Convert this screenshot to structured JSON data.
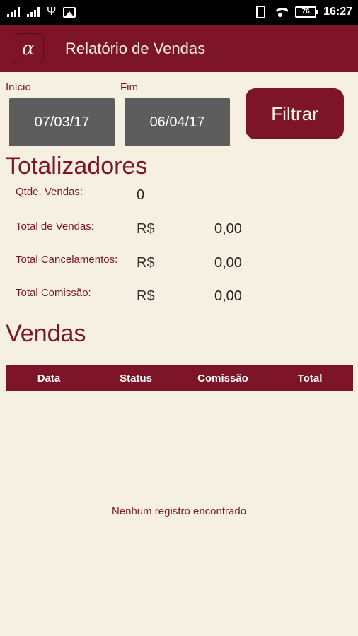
{
  "status_bar": {
    "signal1": "4G",
    "signal2": "4G",
    "battery": "76",
    "time": "16:27"
  },
  "app_bar": {
    "logo_glyph": "α",
    "title": "Relatório de Vendas"
  },
  "filters": {
    "start_label": "Início",
    "start_value": "07/03/17",
    "end_label": "Fim",
    "end_value": "06/04/17",
    "filter_button": "Filtrar"
  },
  "totals": {
    "title": "Totalizadores",
    "qty_label": "Qtde. Vendas:",
    "qty_value": "0",
    "sales_label": "Total de Vendas:",
    "sales_currency": "R$",
    "sales_value": "0,00",
    "cancel_label": "Total Cancelamentos:",
    "cancel_currency": "R$",
    "cancel_value": "0,00",
    "commission_label": "Total Comissão:",
    "commission_currency": "R$",
    "commission_value": "0,00"
  },
  "sales": {
    "title": "Vendas",
    "columns": [
      "Data",
      "Status",
      "Comissão",
      "Total"
    ],
    "rows": [],
    "empty_message": "Nenhum registro encontrado"
  },
  "colors": {
    "brand": "#7d1427",
    "background": "#f6f0e3",
    "date_box": "#5d5d5d"
  }
}
